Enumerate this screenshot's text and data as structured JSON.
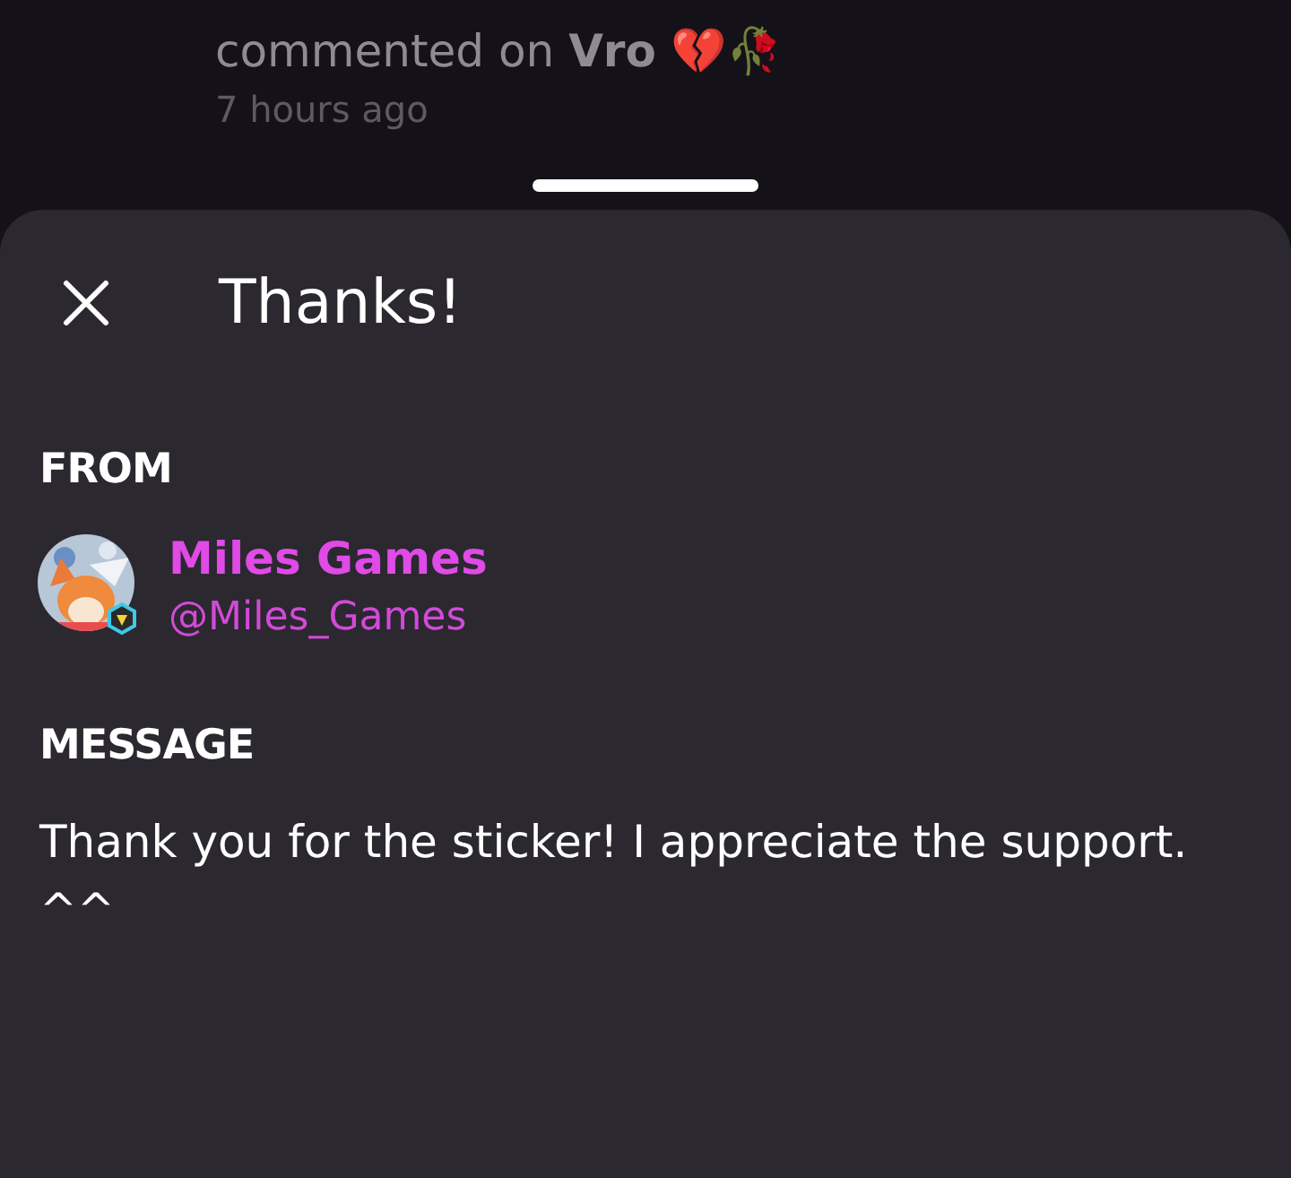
{
  "background_feed": {
    "activity": "commented on **Vro** 💔🥀",
    "time": "7 hours ago"
  },
  "sheet": {
    "title": "Thanks!",
    "from_label": "FROM",
    "sender": {
      "name": "Miles Games",
      "handle": "@Miles_Games"
    },
    "message_label": "MESSAGE",
    "message": "Thank you for the sticker! I appreciate the support.\n^^"
  }
}
